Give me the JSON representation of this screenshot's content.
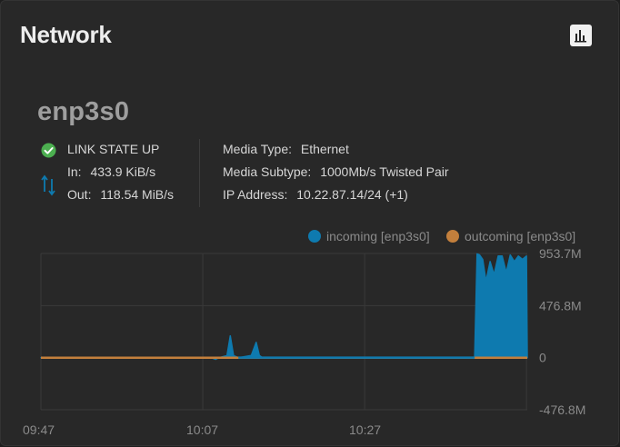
{
  "card": {
    "title": "Network"
  },
  "interface": {
    "name": "enp3s0",
    "link_state": "LINK STATE UP",
    "in_label": "In:",
    "in_value": "433.9 KiB/s",
    "out_label": "Out:",
    "out_value": "118.54 MiB/s",
    "media_type_label": "Media Type:",
    "media_type_value": "Ethernet",
    "media_subtype_label": "Media Subtype:",
    "media_subtype_value": "1000Mb/s Twisted Pair",
    "ip_label": "IP Address:",
    "ip_value": "10.22.87.14/24 (+1)"
  },
  "colors": {
    "incoming": "#0e7aaf",
    "outgoing": "#c37f3c",
    "link_ok": "#4caf50",
    "grid": "#3a3a3a"
  },
  "chart_data": {
    "type": "area",
    "legend": [
      "incoming [enp3s0]",
      "outcoming [enp3s0]"
    ],
    "legend_position": "top-right",
    "x_ticks": [
      "09:47",
      "10:07",
      "10:27"
    ],
    "y_ticks": [
      "953.7M",
      "476.8M",
      "0",
      "-476.8M"
    ],
    "ylim": [
      -476.8,
      953.7
    ],
    "y_unit": "M",
    "x": [
      0,
      21,
      21.6,
      22,
      23,
      23.4,
      23.8,
      24.4,
      26,
      26.6,
      27,
      27.4,
      27.8,
      28.4,
      53.6,
      53.9,
      54.2,
      54.6,
      55,
      55.5,
      56,
      56.5,
      57,
      57.5,
      58,
      58.5,
      59,
      59.5,
      60,
      60.1
    ],
    "series": [
      {
        "name": "incoming [enp3s0]",
        "values": [
          0,
          0,
          -15,
          0,
          20,
          200,
          20,
          0,
          20,
          140,
          20,
          0,
          0,
          0,
          0,
          950,
          940,
          900,
          700,
          880,
          760,
          930,
          930,
          780,
          940,
          880,
          930,
          900,
          930,
          0
        ]
      },
      {
        "name": "outcoming [enp3s0]",
        "values": [
          0,
          0,
          0,
          0,
          0,
          0,
          0,
          0,
          0,
          0,
          0,
          0,
          0,
          0,
          0,
          0,
          0,
          0,
          0,
          0,
          0,
          0,
          0,
          0,
          0,
          0,
          0,
          0,
          0,
          0
        ]
      }
    ],
    "xlim": [
      0,
      60.1
    ],
    "grid": true
  }
}
